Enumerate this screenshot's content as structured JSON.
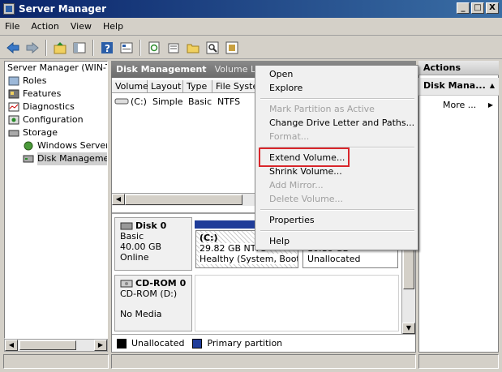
{
  "window": {
    "title": "Server Manager",
    "controls": {
      "minimize": "_",
      "maximize": "□",
      "close": "X"
    }
  },
  "menubar": [
    "File",
    "Action",
    "View",
    "Help"
  ],
  "toolbar": [
    "back-icon",
    "forward-icon",
    "up-folder-icon",
    "show-hide-tree-icon",
    "help-icon",
    "properties-icon",
    "refresh-icon",
    "settings-icon",
    "open-folder-icon",
    "search-icon",
    "export-icon"
  ],
  "tree": {
    "items": [
      {
        "label": "Server Manager (WIN-TV",
        "icon": "server-icon",
        "indent": 0
      },
      {
        "label": "Roles",
        "icon": "roles-icon",
        "indent": 1
      },
      {
        "label": "Features",
        "icon": "features-icon",
        "indent": 1
      },
      {
        "label": "Diagnostics",
        "icon": "diagnostics-icon",
        "indent": 1
      },
      {
        "label": "Configuration",
        "icon": "configuration-icon",
        "indent": 1
      },
      {
        "label": "Storage",
        "icon": "storage-icon",
        "indent": 1
      },
      {
        "label": "Windows Server B",
        "icon": "backup-icon",
        "indent": 2
      },
      {
        "label": "Disk Management",
        "icon": "disk-management-icon",
        "indent": 2,
        "selected": true
      }
    ]
  },
  "center": {
    "header_title": "Disk Management",
    "header_sub": "Volume List",
    "columns": [
      "Volume",
      "Layout",
      "Type",
      "File Syste"
    ],
    "rows": [
      {
        "volume": "(C:)",
        "layout": "Simple",
        "type": "Basic",
        "fs": "NTFS"
      }
    ],
    "disks": [
      {
        "name": "Disk 0",
        "type": "Basic",
        "size": "40.00 GB",
        "state": "Online"
      },
      {
        "name": "CD-ROM 0",
        "type": "CD-ROM (D:)",
        "size": "",
        "state": "No Media"
      }
    ],
    "partitions": {
      "c_title": "(C:)",
      "c_size": "29.82 GB NTFS",
      "c_status": "Healthy (System, Boot, P",
      "unalloc_size": "10.18 GB",
      "unalloc_label": "Unallocated"
    },
    "legend": [
      {
        "label": "Unallocated",
        "color": "#000000"
      },
      {
        "label": "Primary partition",
        "color": "#1f3c99"
      }
    ]
  },
  "actions": {
    "title": "Actions",
    "section": "Disk Mana...",
    "more": "More ..."
  },
  "context_menu": {
    "items": {
      "open": "Open",
      "explore": "Explore",
      "mark_active": "Mark Partition as Active",
      "change_letter": "Change Drive Letter and Paths...",
      "format": "Format...",
      "extend": "Extend Volume...",
      "shrink": "Shrink Volume...",
      "add_mirror": "Add Mirror...",
      "delete": "Delete Volume...",
      "properties": "Properties",
      "help": "Help"
    }
  },
  "colors": {
    "highlight_box": "#d9262b",
    "primary_partition": "#1f3c99"
  }
}
